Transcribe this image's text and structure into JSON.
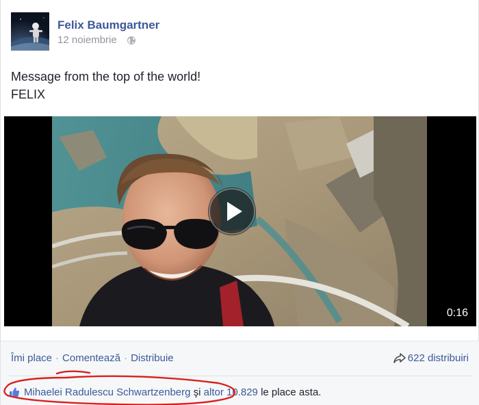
{
  "post": {
    "author": "Felix Baumgartner",
    "date": "12 noiembrie",
    "privacy_icon": "globe-icon",
    "message_lines": [
      "Message from the top of the world!",
      "FELIX"
    ]
  },
  "video": {
    "duration": "0:16",
    "play_icon": "play-icon"
  },
  "actions": {
    "like": "Îmi place",
    "comment": "Comentează",
    "share": "Distribuie",
    "separator": "·",
    "shares_count": "622 distribuiri",
    "shares_icon": "share-arrow-icon"
  },
  "likes": {
    "icon": "thumbs-up-icon",
    "liker_name": "Mihaelei Radulescu Schwartzenberg",
    "connector": "şi",
    "others": "altor 10.829",
    "suffix": "le place asta."
  },
  "colors": {
    "link": "#3b5998",
    "text": "#1d2129",
    "muted": "#90949c",
    "action_bar_bg": "#f6f7f9",
    "highlight_ink": "#d9201c"
  }
}
